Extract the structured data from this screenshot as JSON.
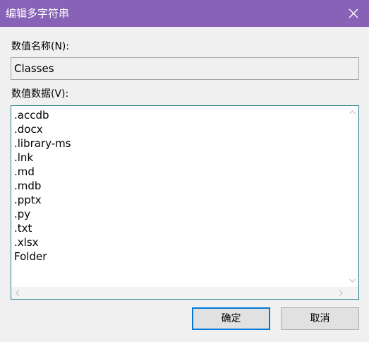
{
  "dialog": {
    "title": "编辑多字符串"
  },
  "value_name": {
    "label": "数值名称(N):",
    "value": "Classes"
  },
  "value_data": {
    "label": "数值数据(V):",
    "lines": [
      ".accdb",
      ".docx",
      ".library-ms",
      ".lnk",
      ".md",
      ".mdb",
      ".pptx",
      ".py",
      ".txt",
      ".xlsx",
      "Folder"
    ]
  },
  "buttons": {
    "ok": "确定",
    "cancel": "取消"
  },
  "colors": {
    "titlebar": "#8762b7",
    "focus_border": "#0078d7",
    "textarea_border": "#2b7d8f"
  },
  "icons": {
    "close": "close-icon",
    "scroll_up": "chevron-up-icon",
    "scroll_down": "chevron-down-icon",
    "scroll_left": "chevron-left-icon",
    "scroll_right": "chevron-right-icon"
  }
}
